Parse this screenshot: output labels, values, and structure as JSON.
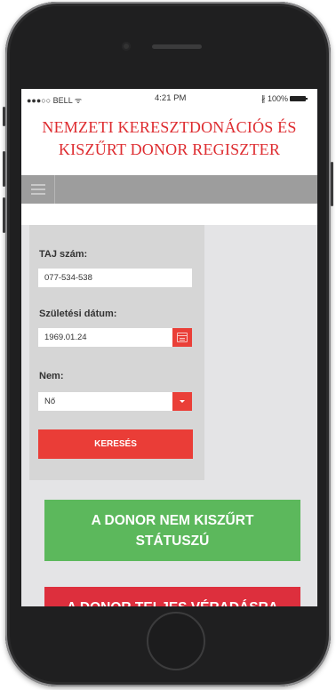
{
  "statusbar": {
    "carrier": "●●●○○ BELL ᯤ",
    "time": "4:21 PM",
    "battery_pct": "∦ 100%"
  },
  "header": {
    "title_line1": "NEMZETI KERESZTDONÁCIÓS ÉS",
    "title_line2": "KISZŰRT DONOR REGISZTER"
  },
  "form": {
    "taj_label": "TAJ szám:",
    "taj_value": "077-534-538",
    "dob_label": "Születési dátum:",
    "dob_value": "1969.01.24",
    "sex_label": "Nem:",
    "sex_value": "Nő",
    "search_button": "KERESÉS"
  },
  "results": {
    "green_line1": "A DONOR NEM KISZŰRT",
    "green_line2": "STÁTUSZÚ",
    "red_line1": "A DONOR TELJES VÉRADÁSRA"
  },
  "colors": {
    "accent_red": "#ea3d37",
    "title_red": "#de2c30",
    "status_green": "#5cb85c",
    "status_red": "#dd2f3d",
    "nav_gray": "#9d9d9d"
  },
  "icons": {
    "menu": "hamburger-icon",
    "calendar": "calendar-icon",
    "dropdown": "chevron-down-icon"
  }
}
